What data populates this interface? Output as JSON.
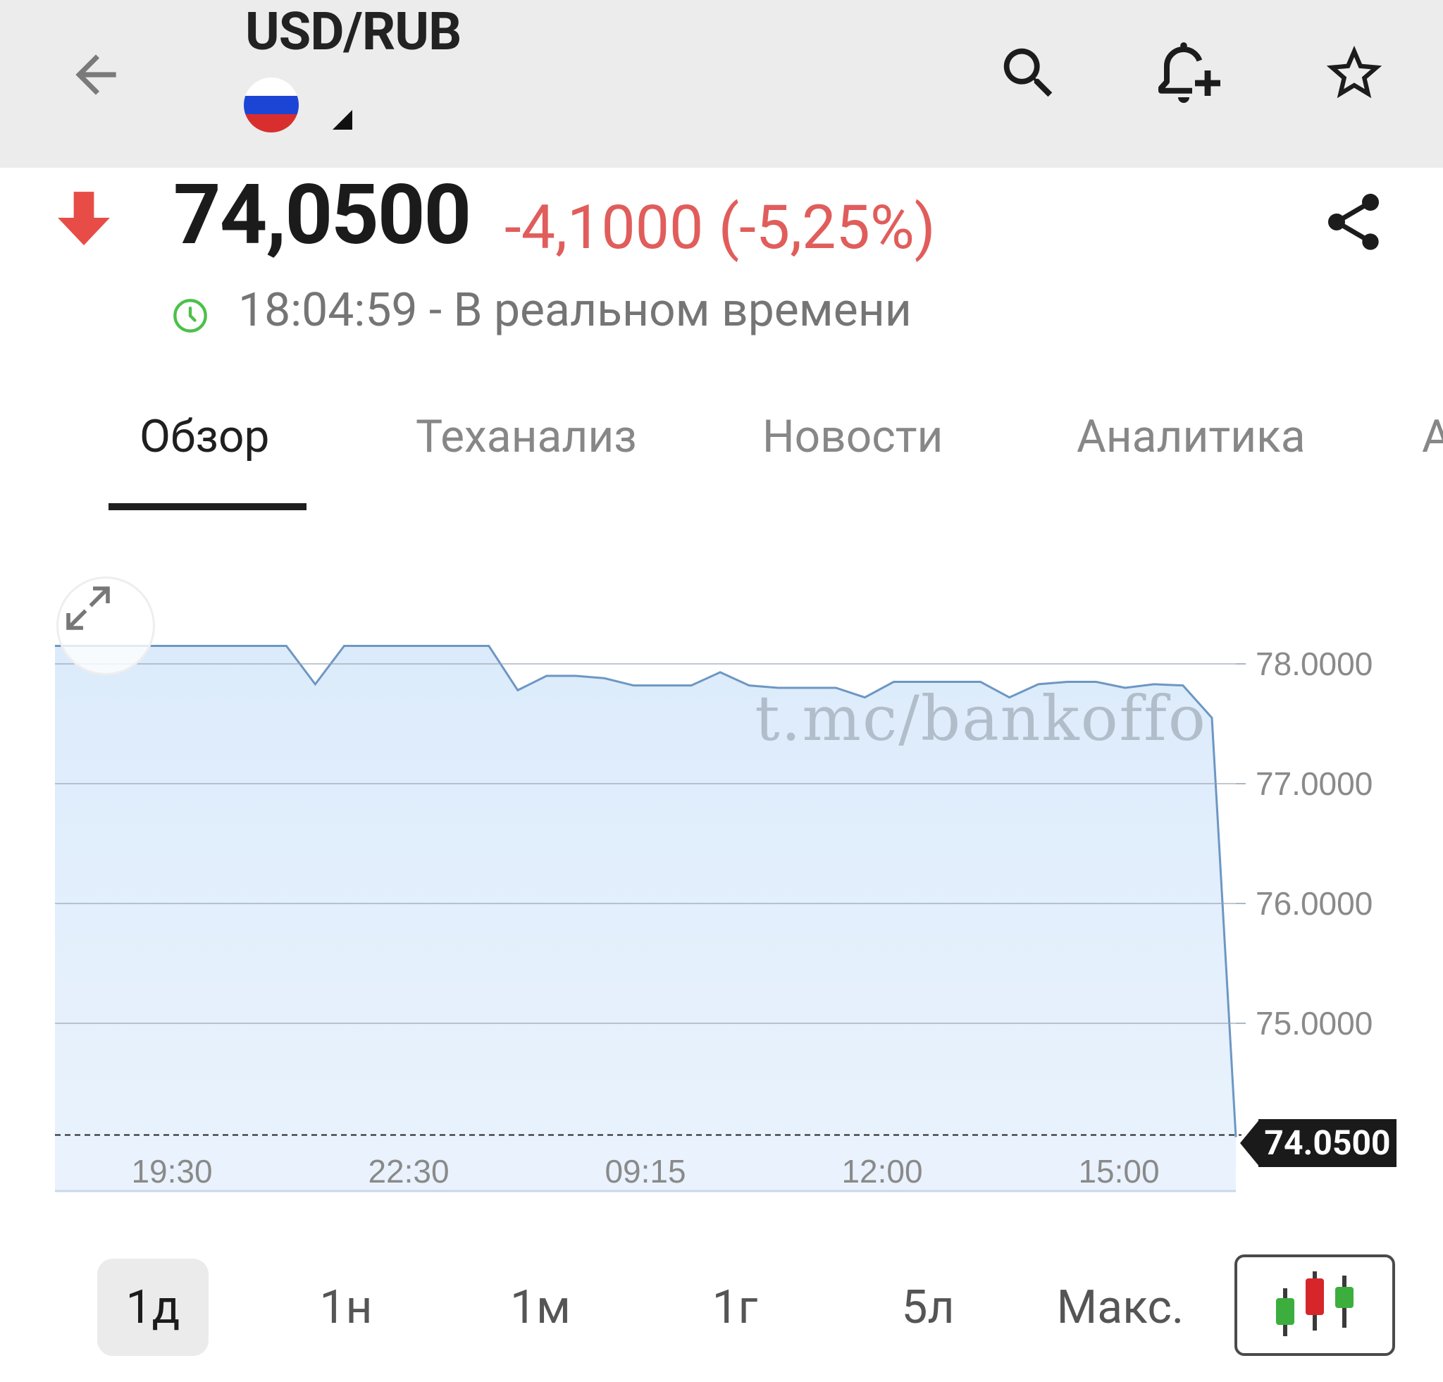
{
  "header": {
    "symbol": "USD/RUB",
    "flag_colors": [
      "#ffffff",
      "#1c45d6",
      "#d92e2e"
    ],
    "icons": [
      "back-arrow-icon",
      "search-icon",
      "add-alert-bell-icon",
      "star-icon"
    ]
  },
  "quote": {
    "price": "74,0500",
    "change": "-4,1000 (-5,25%)",
    "direction": "down",
    "status_text": "18:04:59 - В реальном времени",
    "colors": {
      "down": "#e05d5b",
      "realtime": "#4cc04a"
    }
  },
  "tabs": [
    {
      "label": "Обзор",
      "active": true
    },
    {
      "label": "Теханализ",
      "active": false
    },
    {
      "label": "Новости",
      "active": false
    },
    {
      "label": "Аналитика",
      "active": false
    },
    {
      "label": "А",
      "active": false
    }
  ],
  "chart_data": {
    "type": "area",
    "x_tick_labels": [
      "19:30",
      "22:30",
      "09:15",
      "12:00",
      "15:00"
    ],
    "y_tick_labels": [
      "78.0000",
      "77.0000",
      "76.0000",
      "75.0000"
    ],
    "ylim": [
      74.0,
      78.0
    ],
    "current_value_label": "74.0500",
    "current_value": 74.05,
    "watermark": "t.mc/bankoffo",
    "grid": true,
    "line_color": "#6d97c3",
    "fill_color": "#dcebfb",
    "values": [
      78.15,
      78.15,
      78.15,
      78.15,
      78.15,
      78.15,
      78.15,
      78.15,
      78.15,
      77.83,
      78.15,
      78.15,
      78.15,
      78.15,
      78.15,
      78.15,
      77.78,
      77.9,
      77.9,
      77.88,
      77.82,
      77.82,
      77.82,
      77.93,
      77.82,
      77.8,
      77.8,
      77.8,
      77.72,
      77.85,
      77.85,
      77.85,
      77.85,
      77.72,
      77.83,
      77.85,
      77.85,
      77.8,
      77.83,
      77.82,
      77.55,
      74.05
    ]
  },
  "periods": [
    {
      "label": "1д",
      "active": true
    },
    {
      "label": "1н",
      "active": false
    },
    {
      "label": "1м",
      "active": false
    },
    {
      "label": "1г",
      "active": false
    },
    {
      "label": "5л",
      "active": false
    },
    {
      "label": "Макс.",
      "active": false
    }
  ],
  "chart_type_button": {
    "icon": "candlestick-chart-icon",
    "colors": [
      "#3cae3e",
      "#d6262a",
      "#3cae3e"
    ]
  }
}
